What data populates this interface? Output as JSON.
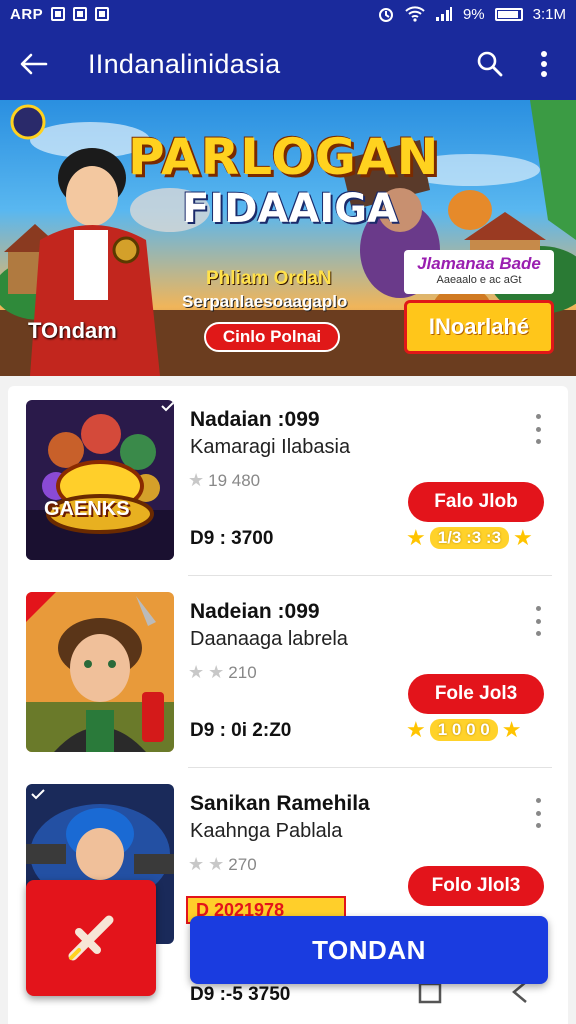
{
  "status_bar": {
    "app_label": "ARP",
    "battery": "9%",
    "time": "3:1M"
  },
  "app_bar": {
    "title": "IIndanalinidasia"
  },
  "banner": {
    "title_line1": "PARLOGAN",
    "title_line2": "FIDAAIGA",
    "subtitle1": "Phliam OrdaN",
    "subtitle2": "Serpanlaesoaagaplo",
    "left_label": "TOndam",
    "red_button": "Cinlo Polnai",
    "badge_title": "Jlamanaa Bade",
    "badge_sub": "Aaeaalo e ac aGt",
    "yellow_button": "INoarlahé"
  },
  "items": [
    {
      "title": "Nadaian :099",
      "subtitle": "Kamaragi Ilabasia",
      "rating": "19 480",
      "price": "D9 : 3700",
      "button": "Falo Jlob",
      "pill": "1/3 :3 :3",
      "thumb_caption": "GAENKS"
    },
    {
      "title": "Nadeian :099",
      "subtitle": "Daanaaga labrela",
      "rating": "210",
      "price": "D9 : 0i 2:Z0",
      "button": "Fole Jol3",
      "pill": "1 0  0 0",
      "thumb_caption": ""
    },
    {
      "title": "Sanikan Ramehila",
      "subtitle": "Kaahnga Pablala",
      "rating": "270",
      "price": "D9 :-5 3750",
      "button": "Folo Jlol3",
      "pill": "",
      "thumb_caption": ""
    }
  ],
  "promo_strip": "D 2021978",
  "cta": "TONDAN"
}
